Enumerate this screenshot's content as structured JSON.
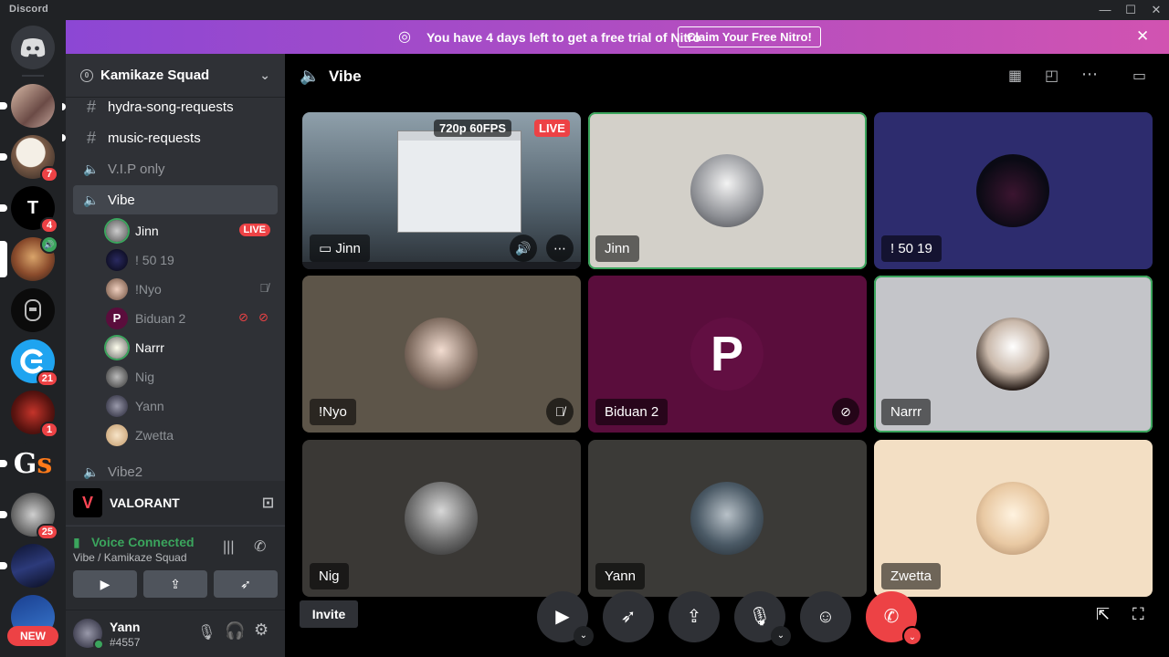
{
  "app": {
    "name": "Discord"
  },
  "window": {
    "minimize": "—",
    "maximize": "☐",
    "close": "✕"
  },
  "nitro": {
    "message": "You have 4 days left to get a free trial of Nitro",
    "cta": "Claim Your Free Nitro!"
  },
  "guilds": {
    "new_label": "NEW",
    "badges": [
      "7",
      "4",
      "21",
      "1",
      "25"
    ]
  },
  "server": {
    "name": "Kamikaze Squad"
  },
  "channels": [
    {
      "name": "hydra-song-requests",
      "type": "text"
    },
    {
      "name": "music-requests",
      "type": "text"
    },
    {
      "name": "V.I.P only",
      "type": "voice"
    },
    {
      "name": "Vibe",
      "type": "voice"
    },
    {
      "name": "Vibe2",
      "type": "voice"
    }
  ],
  "voice_users": [
    {
      "name": "Jinn",
      "live": "LIVE"
    },
    {
      "name": "! 50 19"
    },
    {
      "name": "!Nyo"
    },
    {
      "name": "Biduan 2"
    },
    {
      "name": "Narrr"
    },
    {
      "name": "Nig"
    },
    {
      "name": "Yann"
    },
    {
      "name": "Zwetta"
    }
  ],
  "game": {
    "name": "VALORANT"
  },
  "rtc": {
    "status": "Voice Connected",
    "location": "Vibe / Kamikaze Squad"
  },
  "user": {
    "name": "Yann",
    "tag": "#4557"
  },
  "call": {
    "channel": "Vibe",
    "invite": "Invite"
  },
  "stream": {
    "quality": "720p 60FPS",
    "live": "LIVE"
  },
  "tiles": [
    {
      "name": "Jinn"
    },
    {
      "name": "Jinn"
    },
    {
      "name": "! 50 19"
    },
    {
      "name": "!Nyo"
    },
    {
      "name": "Biduan 2"
    },
    {
      "name": "Narrr"
    },
    {
      "name": "Nig"
    },
    {
      "name": "Yann"
    },
    {
      "name": "Zwetta"
    }
  ],
  "colors": {
    "accent": "#5865f2",
    "live": "#ed4245",
    "connected": "#3ba55d",
    "speaking": "#3ba55d"
  }
}
